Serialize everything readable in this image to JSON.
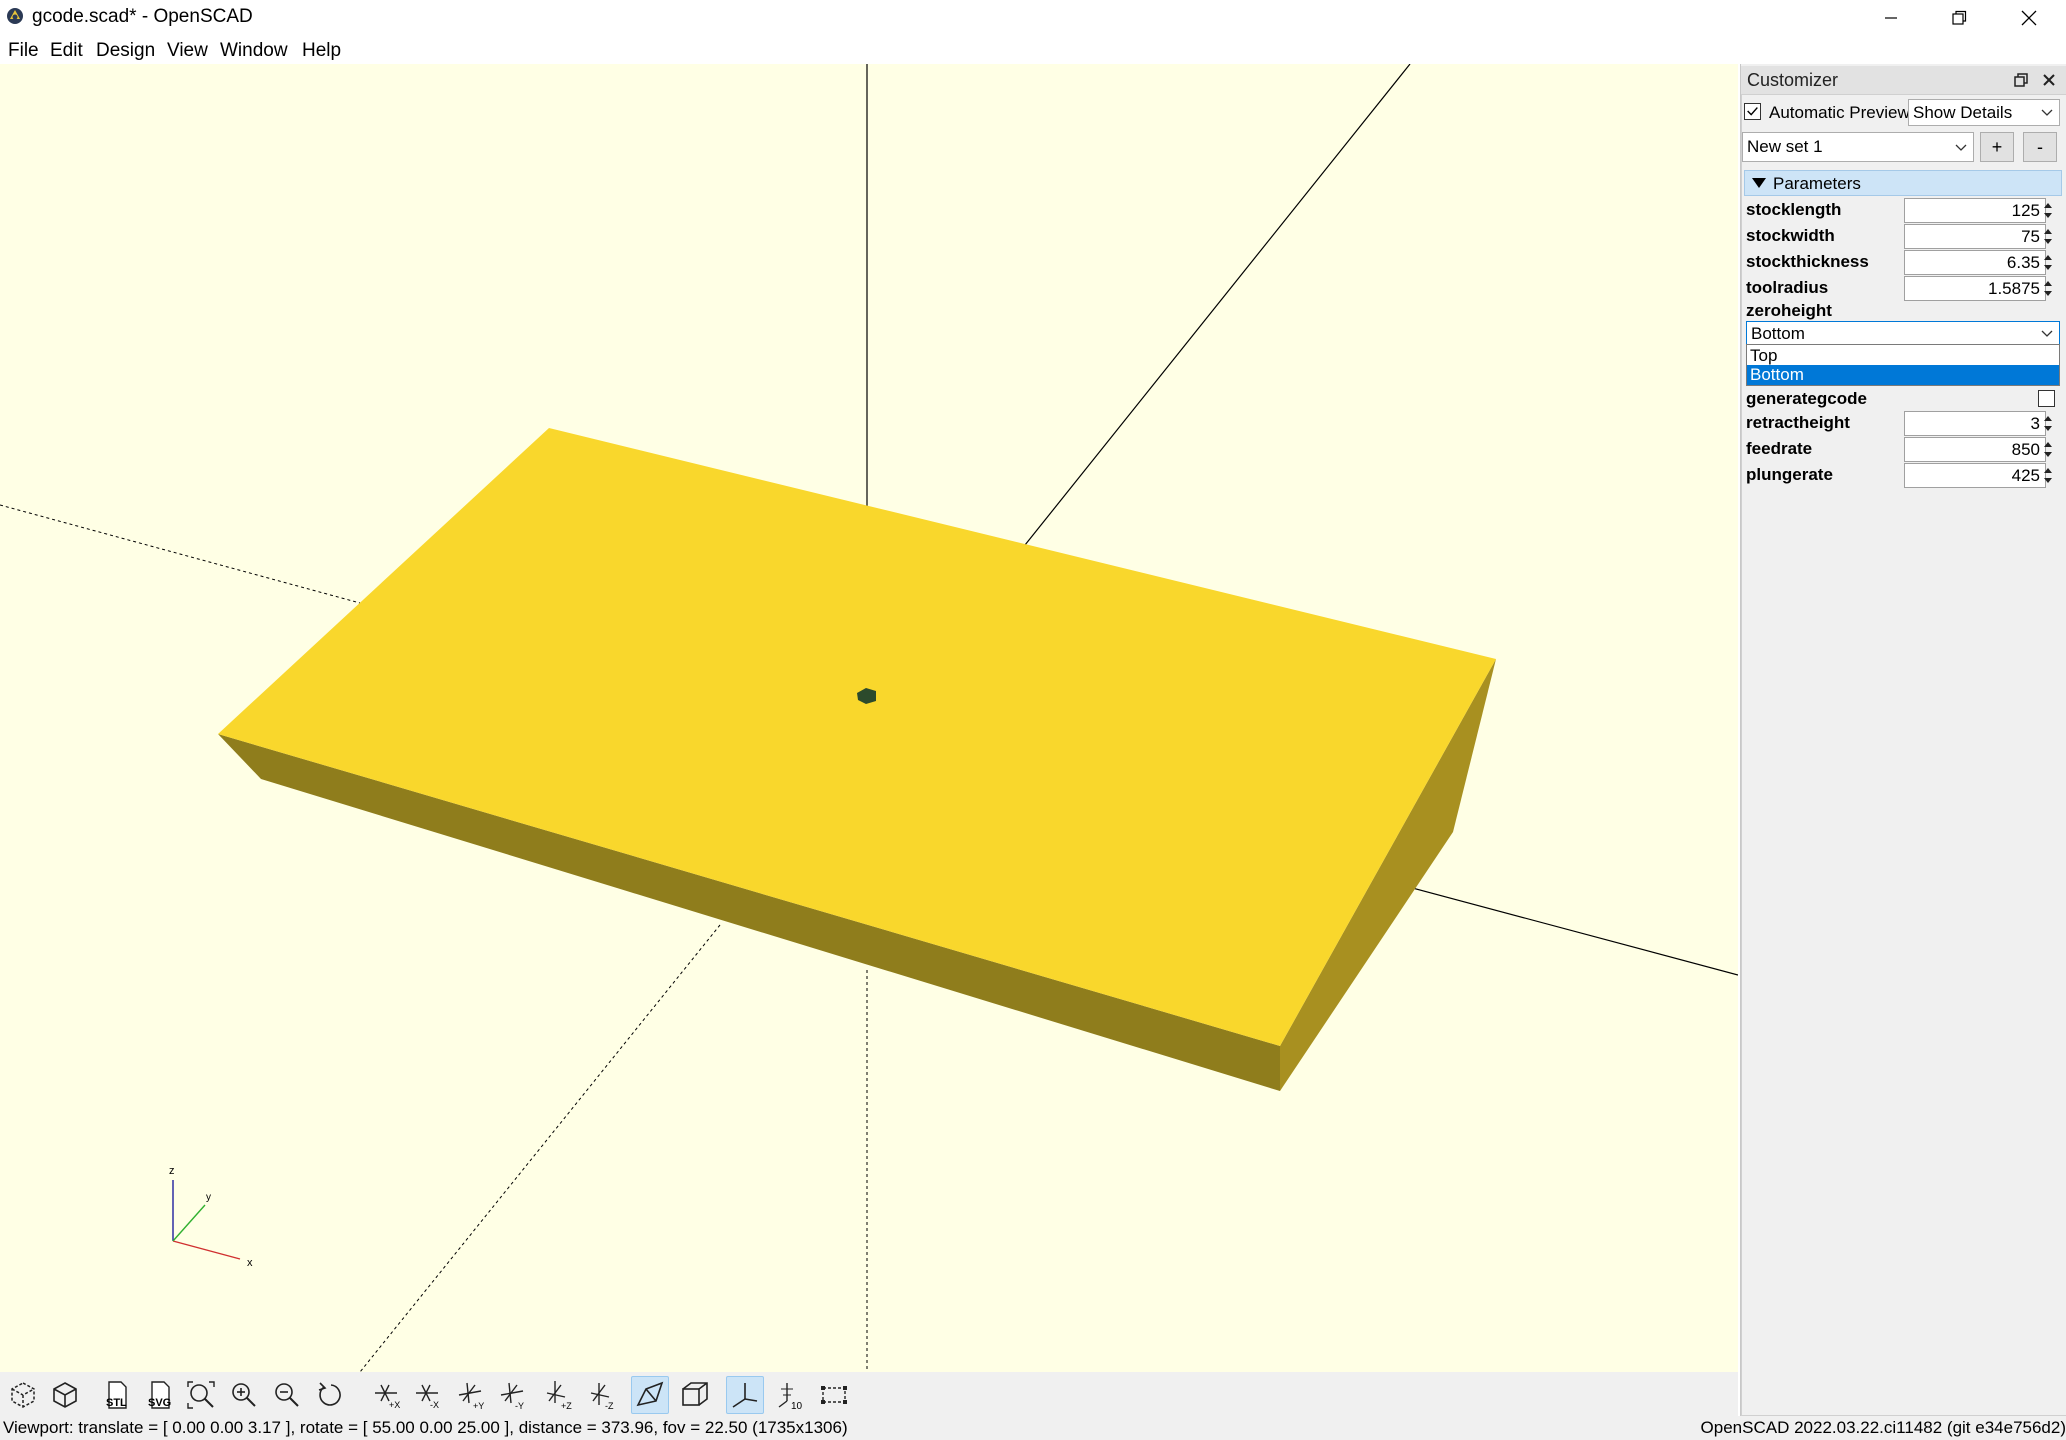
{
  "window": {
    "title": "gcode.scad* - OpenSCAD",
    "icon": "openscad-icon"
  },
  "menu": [
    "File",
    "Edit",
    "Design",
    "View",
    "Window",
    "Help"
  ],
  "viewport": {
    "axes_labels": {
      "x": "x",
      "y": "y",
      "z": "z"
    },
    "background": "#ffffe5",
    "model_color_top": "#f9d72c",
    "model_color_front": "#8f7d1c",
    "model_color_side": "#a89020"
  },
  "toolbar": {
    "buttons": [
      "preview-icon",
      "render-icon",
      "export-stl-icon",
      "export-svg-icon",
      "view-all-icon",
      "zoom-in-icon",
      "zoom-out-icon",
      "reset-view-icon",
      "view-right-icon",
      "view-left-icon",
      "view-back-icon",
      "view-front-icon",
      "view-top-icon",
      "view-bottom-icon",
      "perspective-icon",
      "orthogonal-icon",
      "show-axes-icon",
      "show-scale-icon",
      "show-edges-icon"
    ],
    "stl_label": "STL",
    "svg_label": "SVG"
  },
  "status": {
    "left": "Viewport: translate = [ 0.00 0.00 3.17 ], rotate = [ 55.00 0.00 25.00 ], distance = 373.96, fov = 22.50 (1735x1306)",
    "right": "OpenSCAD 2022.03.22.ci11482 (git e34e756d2)"
  },
  "customizer": {
    "title": "Customizer",
    "automatic_preview_label": "Automatic Preview",
    "automatic_preview_checked": true,
    "details_mode": "Show Details",
    "preset": "New set 1",
    "add_label": "+",
    "remove_label": "-",
    "group_label": "Parameters",
    "params_top": [
      {
        "name": "stocklength",
        "value": "125"
      },
      {
        "name": "stockwidth",
        "value": "75"
      },
      {
        "name": "stockthickness",
        "value": "6.35"
      },
      {
        "name": "toolradius",
        "value": "1.5875"
      }
    ],
    "zeroheight": {
      "name": "zeroheight",
      "selected": "Bottom",
      "options": [
        "Top",
        "Bottom"
      ]
    },
    "generategcode": {
      "name": "generategcode",
      "checked": false
    },
    "params_bottom": [
      {
        "name": "retractheight",
        "value": "3"
      },
      {
        "name": "feedrate",
        "value": "850"
      },
      {
        "name": "plungerate",
        "value": "425"
      }
    ]
  }
}
